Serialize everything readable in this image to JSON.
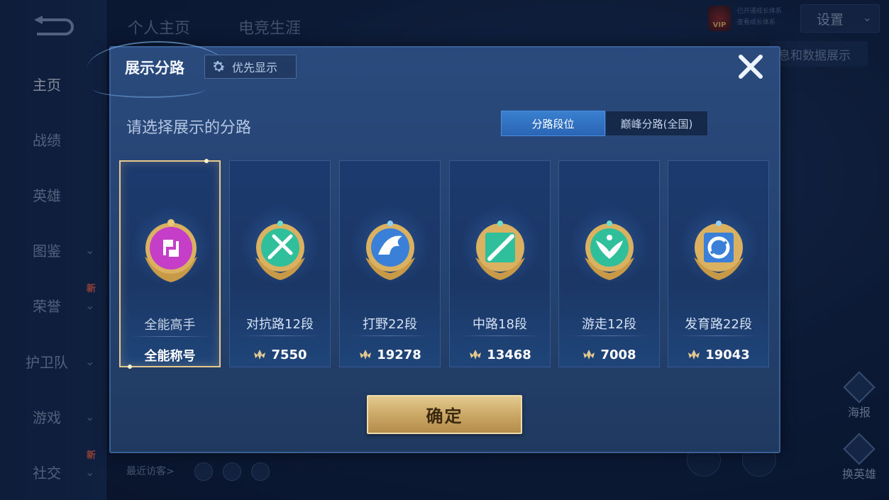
{
  "sidebar": {
    "items": [
      {
        "label": "主页"
      },
      {
        "label": "战绩"
      },
      {
        "label": "英雄"
      },
      {
        "label": "图鉴"
      },
      {
        "label": "荣誉",
        "badge": "新"
      },
      {
        "label": "护卫队"
      },
      {
        "label": "游戏"
      },
      {
        "label": "社交",
        "badge": "新"
      }
    ]
  },
  "top_tabs": [
    "个人主页",
    "电竞生涯"
  ],
  "header_right": {
    "vip_label": "VIP",
    "info_lines": [
      "·已开通成长体系",
      "·查看成长体系"
    ],
    "settings_label": "设置",
    "banner_text": "息和数据展示"
  },
  "right_actions": [
    "海报",
    "换英雄"
  ],
  "recent_visitors_label": "最近访客>",
  "dialog": {
    "title": "展示分路",
    "priority_label": "优先显示",
    "subtitle": "请选择展示的分路",
    "segments": [
      "分路段位",
      "巅峰分路(全国)"
    ],
    "active_segment": 0,
    "confirm_label": "确定",
    "cards": [
      {
        "name": "全能高手",
        "footer": "全能称号",
        "selected": true,
        "emblem": "versatile-emblem",
        "color": "#c43ec8"
      },
      {
        "name": "对抗路12段",
        "footer": "7550",
        "selected": false,
        "emblem": "clash-lane-emblem",
        "color": "#2fbf9a"
      },
      {
        "name": "打野22段",
        "footer": "19278",
        "selected": false,
        "emblem": "jungle-emblem",
        "color": "#3a7fd8"
      },
      {
        "name": "中路18段",
        "footer": "13468",
        "selected": false,
        "emblem": "mid-lane-emblem",
        "color": "#2fbf9a"
      },
      {
        "name": "游走12段",
        "footer": "7008",
        "selected": false,
        "emblem": "roam-emblem",
        "color": "#2fbf9a"
      },
      {
        "name": "发育路22段",
        "footer": "19043",
        "selected": false,
        "emblem": "farm-lane-emblem",
        "color": "#3a7fd8"
      }
    ]
  },
  "colors": {
    "gold": "#e5c98f",
    "accent_blue": "#3a7fd0",
    "dialog_bg": "#24426f"
  }
}
